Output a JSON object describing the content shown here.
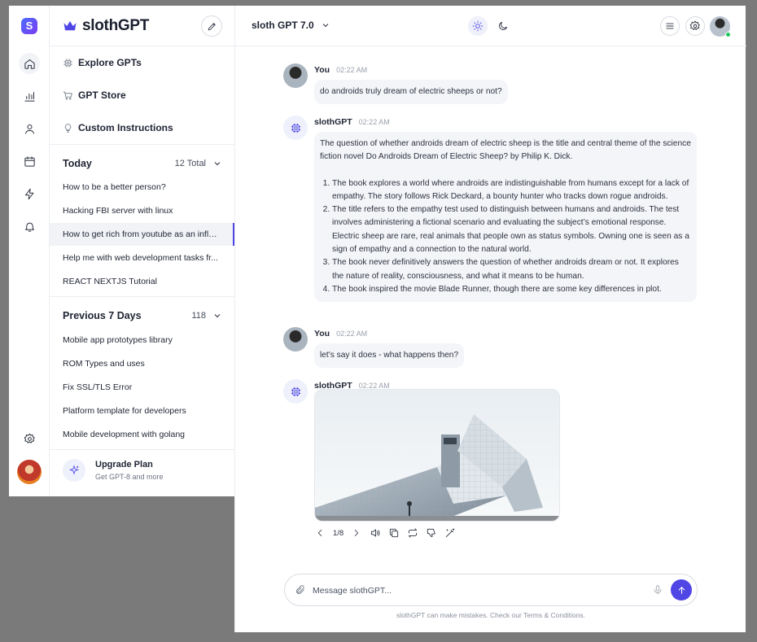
{
  "rail": {
    "logo_letter": "S",
    "items": [
      "home-icon",
      "chart-icon",
      "user-icon",
      "calendar-icon",
      "bolt-icon",
      "bell-icon"
    ],
    "settings_icon": "gear-icon"
  },
  "sidebar": {
    "brand": "slothGPT",
    "nav": [
      {
        "label": "Explore GPTs",
        "icon": "chip-icon"
      },
      {
        "label": "GPT Store",
        "icon": "cart-icon"
      },
      {
        "label": "Custom Instructions",
        "icon": "bulb-icon"
      }
    ],
    "today": {
      "title": "Today",
      "count": "12 Total",
      "items": [
        "How to be a better person?",
        "Hacking FBI server with linux",
        "How to get rich from youtube as an influencer",
        "Help me with web development tasks fr...",
        "REACT NEXTJS Tutorial"
      ],
      "selected_index": 2
    },
    "previous": {
      "title": "Previous 7 Days",
      "count": "118",
      "items": [
        "Mobile app prototypes library",
        "ROM Types and uses",
        "Fix SSL/TLS Error",
        "Platform template for developers",
        "Mobile development with golang"
      ]
    },
    "upgrade": {
      "title": "Upgrade Plan",
      "subtitle": "Get GPT-8 and more"
    }
  },
  "header": {
    "model": "sloth GPT 7.0"
  },
  "messages": [
    {
      "sender": "You",
      "time": "02:22 AM",
      "text": "do androids truly dream of electric sheeps or not?"
    },
    {
      "sender": "slothGPT",
      "time": "02:22 AM",
      "intro": "The question of whether androids dream of electric sheep is the title and central theme of the science fiction novel  Do Androids Dream of Electric Sheep? by Philip K. Dick.",
      "list": [
        "The book explores a world where androids are indistinguishable from humans except for a lack of empathy. The story follows Rick Deckard, a bounty hunter who tracks down rogue androids.",
        "The title refers to the  empathy test used to distinguish between humans and androids. The test involves administering a fictional scenario and evaluating the subject’s emotional response. Electric sheep are rare, real animals that people own as status symbols. Owning one is seen as a sign of empathy and a connection to the natural world.",
        "The book never definitively answers the question of whether androids dream or not. It explores the nature of reality, consciousness, and what it means to be human.",
        "The book inspired the movie Blade Runner, though there are some key differences in plot."
      ]
    },
    {
      "sender": "You",
      "time": "02:22 AM",
      "text": "let's say it does - what happens then?"
    },
    {
      "sender": "slothGPT",
      "time": "02:22 AM",
      "pager": "1/8"
    }
  ],
  "composer": {
    "placeholder": "Message slothGPT..."
  },
  "footer": "slothGPT can make mistakes. Check our Terms & Conditions."
}
